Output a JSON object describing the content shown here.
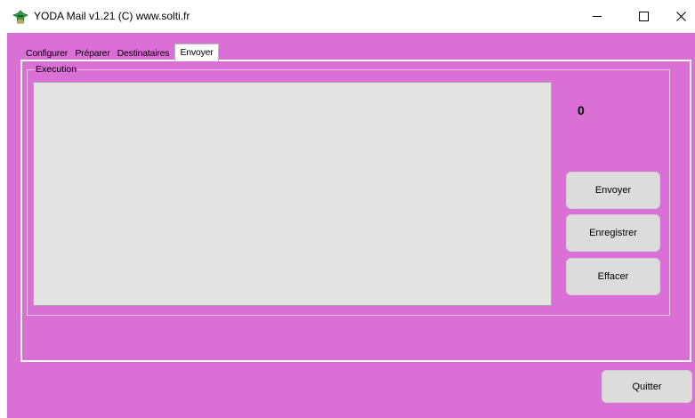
{
  "window": {
    "title": "YODA Mail v1.21 (C) www.solti.fr"
  },
  "tabs": [
    "Configurer",
    "Préparer",
    "Destinataires",
    "Envoyer"
  ],
  "active_tab": "Envoyer",
  "execution": {
    "group_label": "Execution",
    "log_text": "",
    "counter": "0",
    "buttons": {
      "send": "Envoyer",
      "save": "Enregistrer",
      "clear": "Effacer"
    }
  },
  "footer": {
    "quit": "Quitter"
  },
  "colors": {
    "background": "#da70d6",
    "button": "#dcdcdc",
    "log_area": "#e3e3e3"
  }
}
